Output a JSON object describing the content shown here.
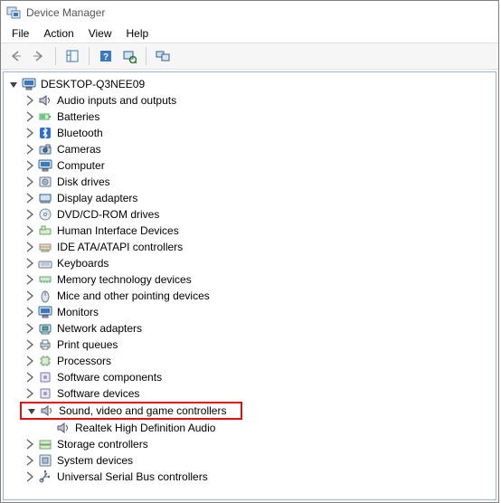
{
  "window": {
    "title": "Device Manager"
  },
  "menu": {
    "file": "File",
    "action": "Action",
    "view": "View",
    "help": "Help"
  },
  "tree": {
    "root": "DESKTOP-Q3NEE09",
    "categories": [
      "Audio inputs and outputs",
      "Batteries",
      "Bluetooth",
      "Cameras",
      "Computer",
      "Disk drives",
      "Display adapters",
      "DVD/CD-ROM drives",
      "Human Interface Devices",
      "IDE ATA/ATAPI controllers",
      "Keyboards",
      "Memory technology devices",
      "Mice and other pointing devices",
      "Monitors",
      "Network adapters",
      "Print queues",
      "Processors",
      "Software components",
      "Software devices",
      "Sound, video and game controllers",
      "Storage controllers",
      "System devices",
      "Universal Serial Bus controllers"
    ],
    "expanded_child": "Realtek High Definition Audio"
  }
}
